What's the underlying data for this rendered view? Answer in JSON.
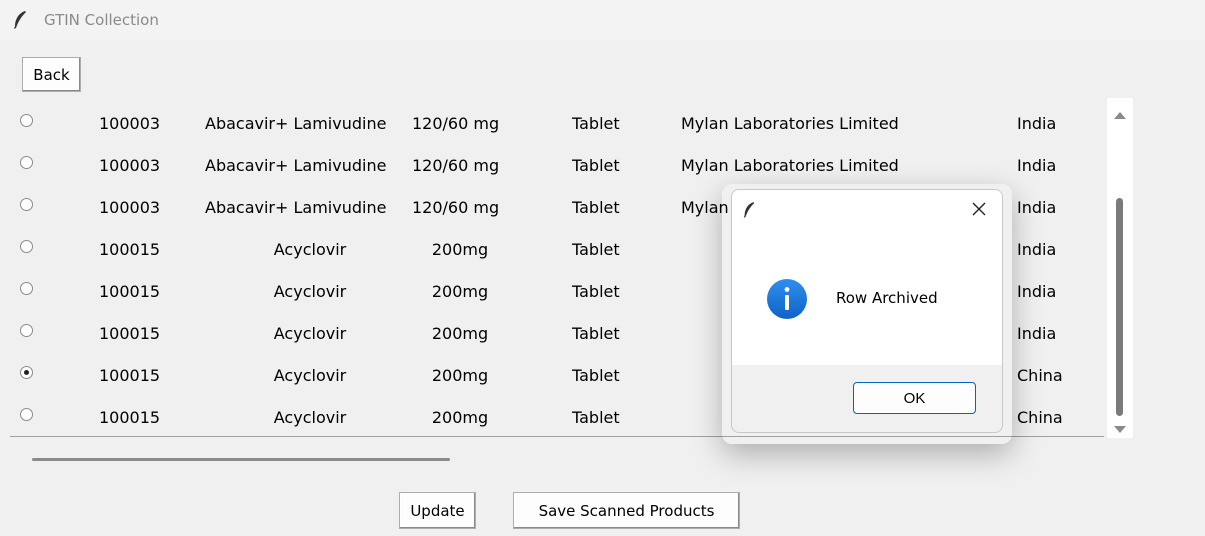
{
  "window": {
    "title": "GTIN Collection",
    "app_icon": "feather-icon"
  },
  "toolbar": {
    "back_label": "Back"
  },
  "rows": [
    {
      "selected": false,
      "id": "100003",
      "name": "Abacavir+ Lamivudine",
      "strength": "120/60 mg",
      "form": "Tablet",
      "manufacturer": "Mylan Laboratories Limited",
      "country": "India"
    },
    {
      "selected": false,
      "id": "100003",
      "name": "Abacavir+ Lamivudine",
      "strength": "120/60 mg",
      "form": "Tablet",
      "manufacturer": "Mylan Laboratories Limited",
      "country": "India"
    },
    {
      "selected": false,
      "id": "100003",
      "name": "Abacavir+ Lamivudine",
      "strength": "120/60 mg",
      "form": "Tablet",
      "manufacturer": "Mylan",
      "country": "India"
    },
    {
      "selected": false,
      "id": "100015",
      "name": "Acyclovir",
      "strength": "200mg",
      "form": "Tablet",
      "manufacturer": "",
      "country": "India"
    },
    {
      "selected": false,
      "id": "100015",
      "name": "Acyclovir",
      "strength": "200mg",
      "form": "Tablet",
      "manufacturer": "",
      "country": "India"
    },
    {
      "selected": false,
      "id": "100015",
      "name": "Acyclovir",
      "strength": "200mg",
      "form": "Tablet",
      "manufacturer": "",
      "country": "India"
    },
    {
      "selected": true,
      "id": "100015",
      "name": "Acyclovir",
      "strength": "200mg",
      "form": "Tablet",
      "manufacturer": "",
      "country": "China"
    },
    {
      "selected": false,
      "id": "100015",
      "name": "Acyclovir",
      "strength": "200mg",
      "form": "Tablet",
      "manufacturer": "",
      "country": "China"
    }
  ],
  "footer": {
    "update_label": "Update",
    "save_label": "Save Scanned Products"
  },
  "dialog": {
    "icon": "info-icon",
    "message": "Row Archived",
    "ok_label": "OK",
    "close_icon": "close-icon"
  },
  "colors": {
    "info_blue": "#1479d8",
    "ok_border": "#0067c0"
  }
}
